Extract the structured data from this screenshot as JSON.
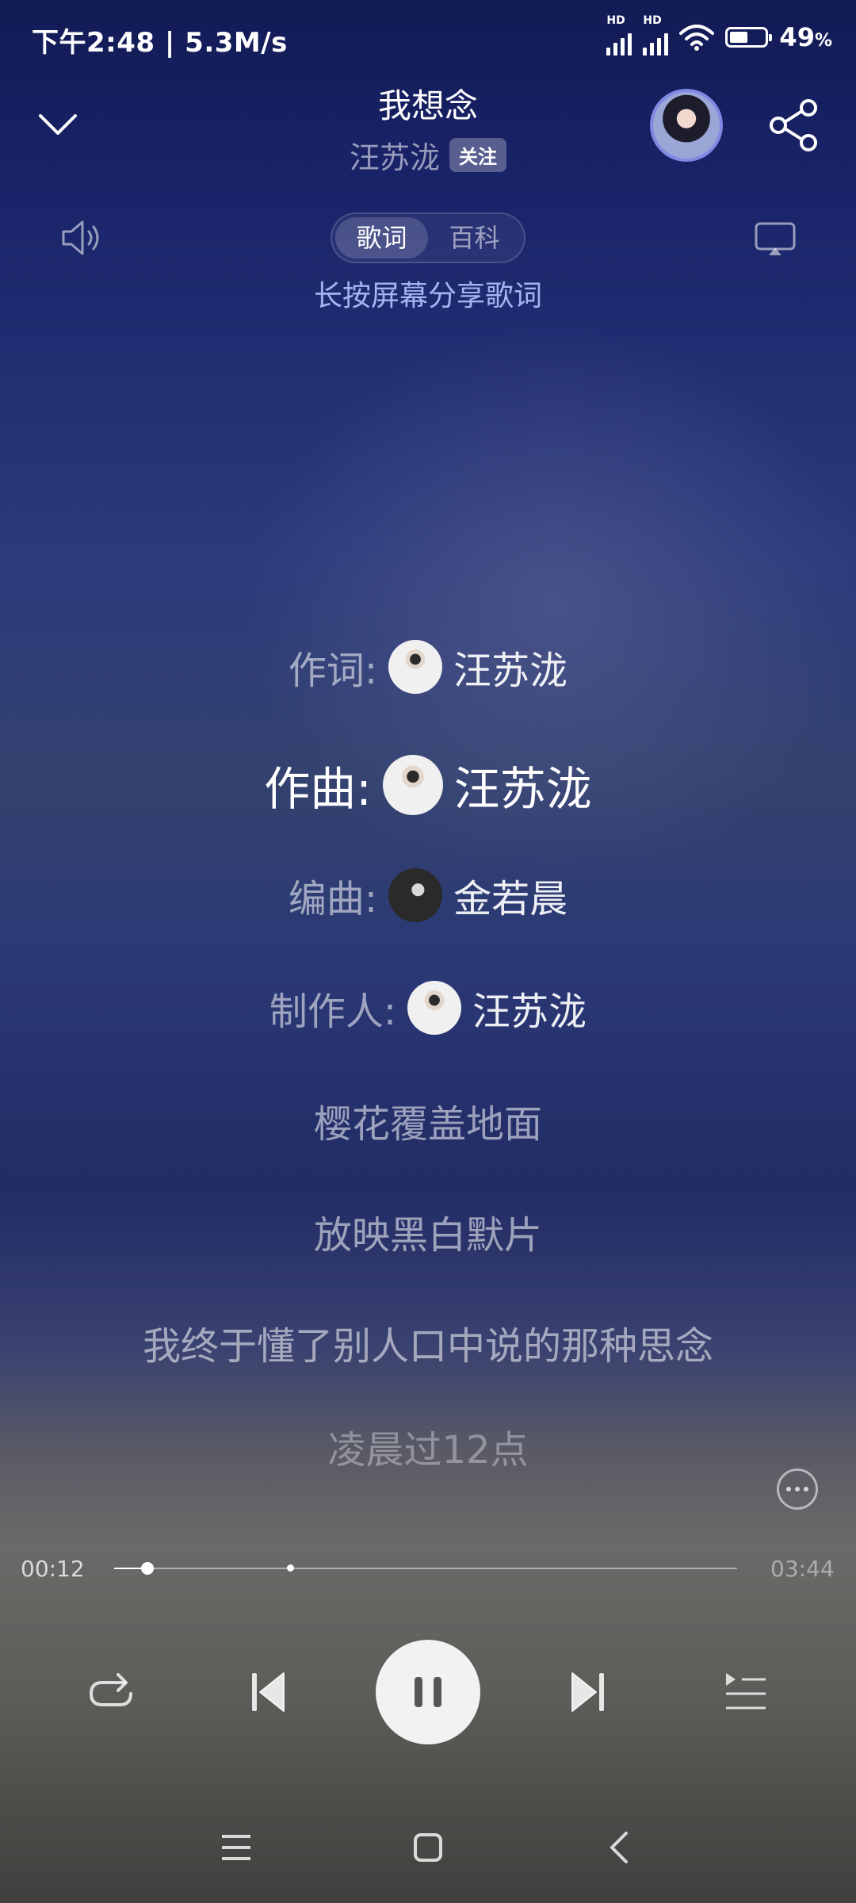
{
  "status_bar": {
    "time_speed": "下午2:48 | 5.3M/s",
    "hd_label": "HD",
    "battery_percent": "49",
    "battery_unit": "%",
    "battery_level": 0.49
  },
  "header": {
    "title": "我想念",
    "artist": "汪苏泷",
    "follow_label": "关注"
  },
  "tabs": [
    {
      "label": "歌词",
      "selected": true
    },
    {
      "label": "百科",
      "selected": false
    }
  ],
  "share_hint": "长按屏幕分享歌词",
  "lyrics": {
    "credits": [
      {
        "role": "作词:",
        "name": "汪苏泷"
      },
      {
        "role": "作曲:",
        "name": "汪苏泷",
        "active": true
      },
      {
        "role": "编曲:",
        "name": "金若晨"
      },
      {
        "role": "制作人:",
        "name": "汪苏泷"
      }
    ],
    "lines": [
      "樱花覆盖地面",
      "放映黑白默片",
      "我终于懂了别人口中说的那种思念",
      "凌晨过12点"
    ]
  },
  "player": {
    "current_time": "00:12",
    "total_time": "03:44",
    "progress": 0.054,
    "buffered": 0.283
  },
  "icons": {
    "back": "chevron-down-icon",
    "share": "share-icon",
    "volume": "volume-icon",
    "cast": "cast-icon",
    "more": "more-icon",
    "repeat": "repeat-icon",
    "previous": "skip-previous-icon",
    "pause": "pause-icon",
    "next": "skip-next-icon",
    "queue": "playlist-icon"
  }
}
